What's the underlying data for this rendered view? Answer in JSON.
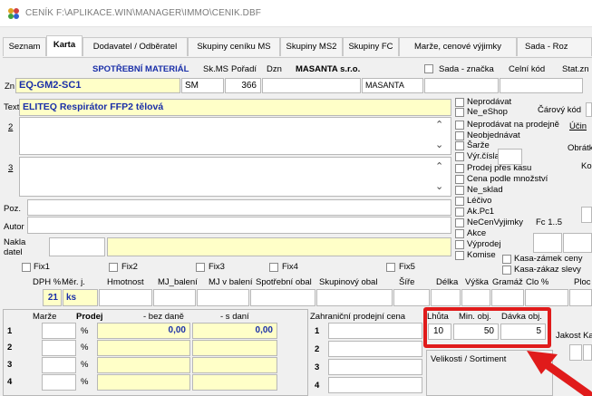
{
  "window": {
    "title": "CENÍK F:\\APLIKACE.WIN\\MANAGER\\IMMO\\CENIK.DBF"
  },
  "tabs": [
    "Seznam",
    "Karta",
    "Dodavatel / Odběratel",
    "Skupiny ceníku MS",
    "Skupiny MS2",
    "Skupiny FC",
    "Marže, cenové výjimky",
    "Sada - Roz"
  ],
  "header": {
    "category": "SPOTŘEBNÍ MATERIÁL",
    "sk_ms_label": "Sk.MS",
    "poradi_label": "Pořadí",
    "dzn_label": "Dzn",
    "company": "MASANTA s.r.o.",
    "sada_label": "Sada - značka",
    "celni_kod_label": "Celní kód",
    "stat_label": "Stat.zn"
  },
  "row_zn": {
    "label": "Zn",
    "code": "EQ-GM2-SC1",
    "sk_ms": "SM",
    "poradi": "366",
    "dzn": "",
    "company_short": "MASANTA"
  },
  "text_field": {
    "label": "Text",
    "value": "ELITEQ Respirátor FFP2 tělová"
  },
  "lines": {
    "two": "2",
    "three": "3"
  },
  "side_labels": {
    "poz": "Poz.",
    "autor": "Autor",
    "naklad_1": "Nakla",
    "naklad_2": "datel"
  },
  "fix_labels": [
    "Fix1",
    "Fix2",
    "Fix3",
    "Fix4",
    "Fix5"
  ],
  "checkboxes": [
    "Neprodávat",
    "Ne_eShop",
    "Neprodávat na prodejně",
    "Neobjednávat",
    "Šarže",
    "Výr.čísla",
    "Prodej přes kasu",
    "Cena podle množství",
    "Ne_sklad",
    "Léčivo",
    "Ak.Pc1",
    "NeCenVyjimky",
    "Akce",
    "Výprodej",
    "Komise"
  ],
  "right_labels": {
    "carovy_kod": "Čárový kód",
    "ucin": "Účin",
    "obratk": "Obrátk",
    "ko": "Ko",
    "fc": "Fc 1..5",
    "kasa_zamek": "Kasa-zámek ceny",
    "kasa_zakaz": "Kasa-zákaz slevy"
  },
  "columns": [
    "DPH %",
    "Měr. j.",
    "Hmotnost",
    "MJ_balení",
    "MJ v balení",
    "Spotřební obal",
    "Skupinový obal",
    "Šíře",
    "Délka",
    "Výška",
    "Gramáž",
    "Clo %",
    "Ploc"
  ],
  "values_row": {
    "dph": "21",
    "mj": "ks"
  },
  "pricing": {
    "marze_label": "Marže",
    "prodej_label": "Prodej",
    "bez_dane_label": "- bez daně",
    "s_dani_label": "- s daní",
    "percent": "%",
    "rows": [
      "1",
      "2",
      "3",
      "4"
    ],
    "bez_dane_1": "0,00",
    "s_dani_1": "0,00"
  },
  "foreign": {
    "label": "Zahraniční prodejní cena",
    "rows": [
      "1",
      "2",
      "3",
      "4"
    ]
  },
  "order": {
    "lhuta_label": "Lhůta",
    "min_obj_label": "Min. obj.",
    "davka_obj_label": "Dávka obj.",
    "lhuta": "10",
    "min_obj": "50",
    "davka_obj": "5",
    "jakost_label": "Jakost Ka"
  },
  "sizes": {
    "label": "Velikosti / Sortiment"
  },
  "colors": {
    "highlight_red": "#e01b1b",
    "label_blue": "#1a2fa8",
    "field_yellow": "#ffffc8"
  },
  "icons": [
    "app-icon",
    "scroll-up-icon",
    "scroll-down-icon",
    "arrow-annotation-icon"
  ]
}
